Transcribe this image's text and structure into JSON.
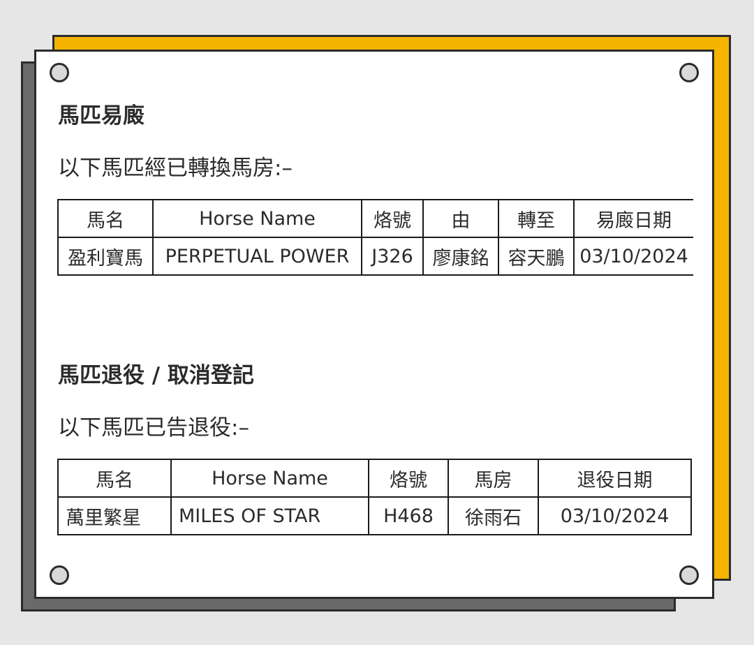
{
  "section1": {
    "title": "馬匹易廄",
    "intro": "以下馬匹經已轉換馬房:–",
    "headers": [
      "馬名",
      "Horse Name",
      "烙號",
      "由",
      "轉至",
      "易廄日期"
    ],
    "rows": [
      [
        "盈利寶馬",
        "PERPETUAL POWER",
        "J326",
        "廖康銘",
        "容天鵬",
        "03/10/2024"
      ]
    ]
  },
  "section2": {
    "title": "馬匹退役 / 取消登記",
    "intro": "以下馬匹已告退役:–",
    "headers": [
      "馬名",
      "Horse Name",
      "烙號",
      "馬房",
      "退役日期"
    ],
    "rows": [
      [
        "萬里繁星",
        "MILES OF STAR",
        "H468",
        "徐雨石",
        "03/10/2024"
      ]
    ]
  },
  "colors": {
    "background": "#e6e6e6",
    "accent_yellow": "#f5b400",
    "shadow_gray": "#6a6a6a",
    "border": "#2b2b2b"
  }
}
